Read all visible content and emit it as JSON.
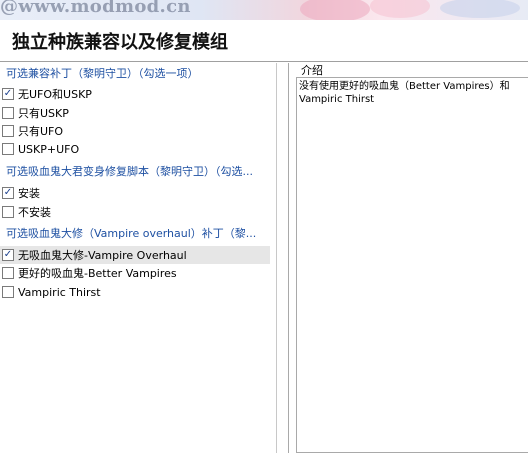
{
  "watermark": "@www.modmod.cn",
  "header": {
    "title": "独立种族兼容以及修复模组"
  },
  "groups": [
    {
      "header": "可选兼容补丁（黎明守卫）（勾选一项）",
      "options": [
        {
          "label": "无UFO和USKP",
          "checked": true
        },
        {
          "label": "只有USKP",
          "checked": false
        },
        {
          "label": "只有UFO",
          "checked": false
        },
        {
          "label": "USKP+UFO",
          "checked": false
        }
      ]
    },
    {
      "header": "可选吸血鬼大君变身修复脚本（黎明守卫）（勾选...",
      "options": [
        {
          "label": "安装",
          "checked": true
        },
        {
          "label": "不安装",
          "checked": false
        }
      ]
    },
    {
      "header": "可选吸血鬼大修（Vampire overhaul）补丁（黎...",
      "options": [
        {
          "label": "无吸血鬼大修-Vampire Overhaul",
          "checked": true
        },
        {
          "label": "更好的吸血鬼-Better Vampires",
          "checked": false
        },
        {
          "label": "Vampiric Thirst",
          "checked": false
        }
      ]
    }
  ],
  "description": {
    "label": "介绍",
    "text": "没有使用更好的吸血鬼（Better Vampires）和 Vampiric Thirst"
  },
  "colors": {
    "group_header": "#1e50a2",
    "selected_row": "#e6e6e6",
    "check_mark": "#1a3e8c"
  }
}
